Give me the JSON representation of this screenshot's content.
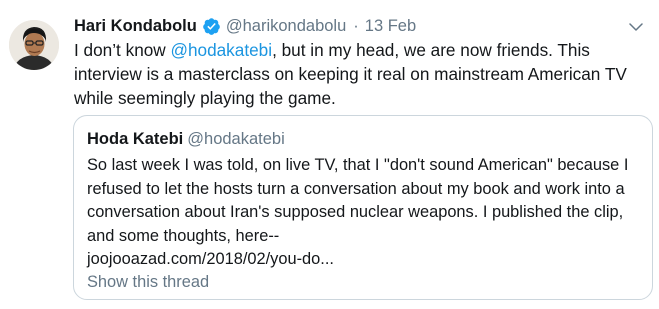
{
  "tweet": {
    "author_name": "Hari Kondabolu",
    "author_handle": "@harikondabolu",
    "separator": "·",
    "date": "13 Feb",
    "text_before": "I don’t know ",
    "mention": "@hodakatebi",
    "text_after": ", but in my head, we are now friends. This interview is a masterclass on keeping it real on mainstream American TV while seemingly playing the game."
  },
  "quoted_tweet": {
    "author_name": "Hoda Katebi",
    "author_handle": "@hodakatebi",
    "text": "So last week I was told, on live TV, that I \"don't sound American\" because I refused to let the hosts turn a conversation about my book and work into a conversation about Iran's supposed nuclear weapons. I published the clip, and some thoughts, here--",
    "link": "joojooazad.com/2018/02/you-do...",
    "show_thread_label": "Show this thread"
  },
  "colors": {
    "text": "#14171a",
    "secondary": "#657786",
    "link": "#1b95e0",
    "verified": "#1da1f2",
    "border": "#ccd6dd"
  },
  "icons": {
    "verified": "verified-badge-icon",
    "menu": "chevron-down-icon"
  }
}
